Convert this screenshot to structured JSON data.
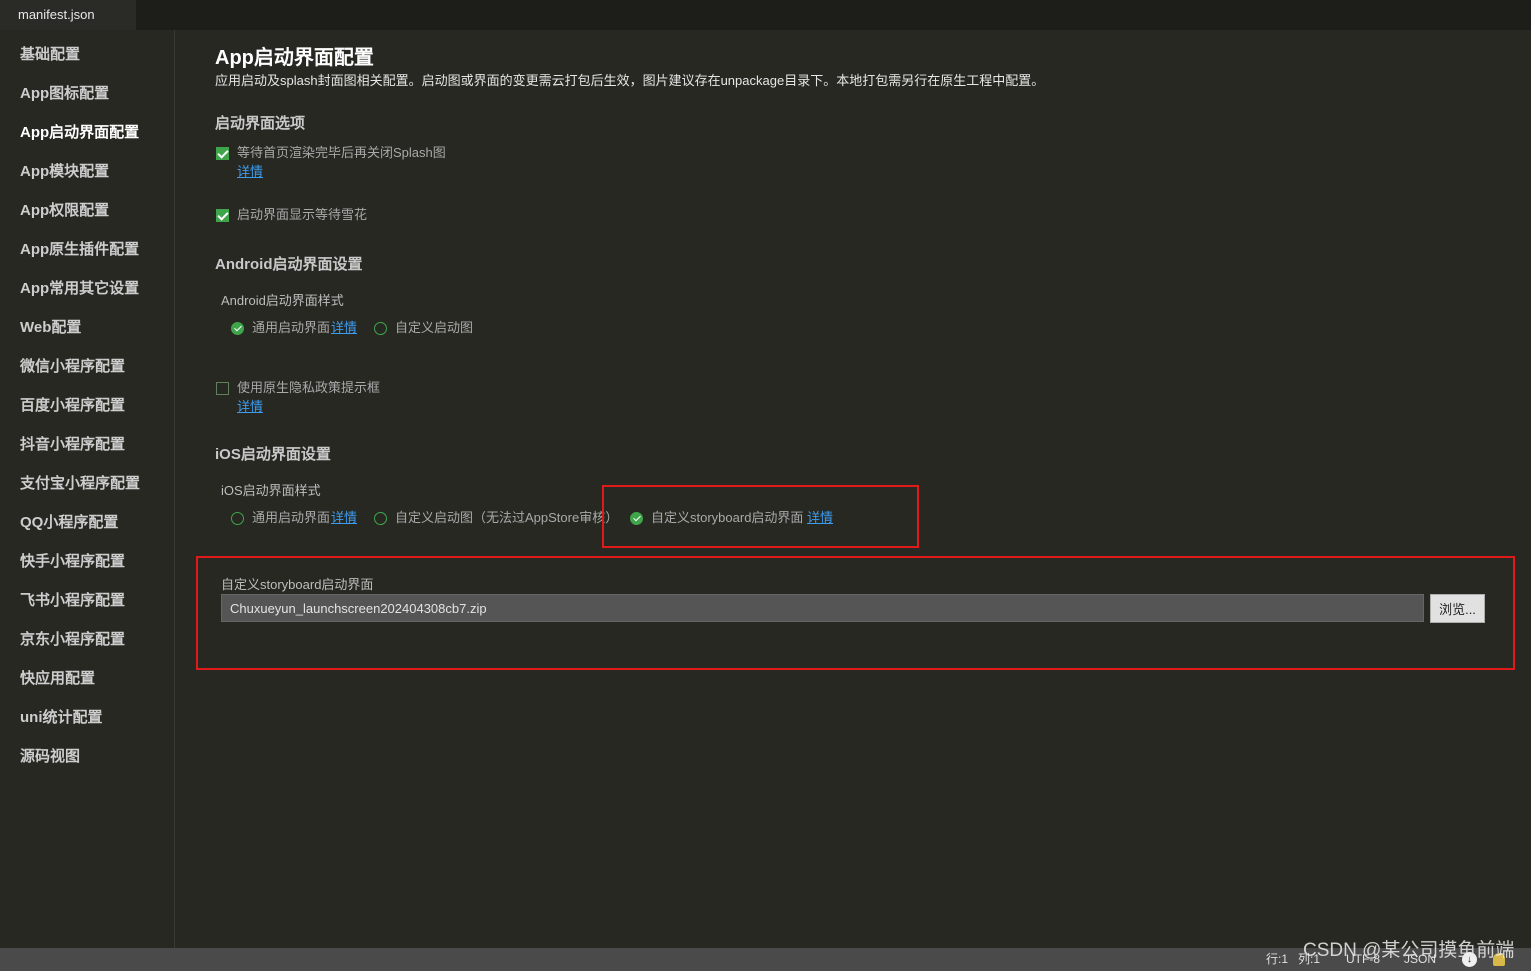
{
  "tab": {
    "title": "manifest.json"
  },
  "sidebar": {
    "items": [
      {
        "label": "基础配置"
      },
      {
        "label": "App图标配置"
      },
      {
        "label": "App启动界面配置",
        "active": true
      },
      {
        "label": "App模块配置"
      },
      {
        "label": "App权限配置"
      },
      {
        "label": "App原生插件配置"
      },
      {
        "label": "App常用其它设置"
      },
      {
        "label": "Web配置"
      },
      {
        "label": "微信小程序配置"
      },
      {
        "label": "百度小程序配置"
      },
      {
        "label": "抖音小程序配置"
      },
      {
        "label": "支付宝小程序配置"
      },
      {
        "label": "QQ小程序配置"
      },
      {
        "label": "快手小程序配置"
      },
      {
        "label": "飞书小程序配置"
      },
      {
        "label": "京东小程序配置"
      },
      {
        "label": "快应用配置"
      },
      {
        "label": "uni统计配置"
      },
      {
        "label": "源码视图"
      }
    ]
  },
  "main": {
    "title": "App启动界面配置",
    "description": "应用启动及splash封面图相关配置。启动图或界面的变更需云打包后生效，图片建议存在unpackage目录下。本地打包需另行在原生工程中配置。",
    "splash_options": {
      "heading": "启动界面选项",
      "wait_render": {
        "label": "等待首页渲染完毕后再关闭Splash图",
        "checked": true,
        "link": "详情"
      },
      "waiting_spinner": {
        "label": "启动界面显示等待雪花",
        "checked": true
      }
    },
    "android": {
      "heading": "Android启动界面设置",
      "style_label": "Android启动界面样式",
      "options": [
        {
          "label": "通用启动界面",
          "selected": true,
          "link": "详情"
        },
        {
          "label": "自定义启动图",
          "selected": false
        }
      ],
      "privacy_dialog": {
        "label": "使用原生隐私政策提示框",
        "checked": false,
        "link": "详情"
      }
    },
    "ios": {
      "heading": "iOS启动界面设置",
      "style_label": "iOS启动界面样式",
      "options": [
        {
          "label": "通用启动界面",
          "selected": false,
          "link": "详情"
        },
        {
          "label": "自定义启动图（无法过AppStore审核）",
          "selected": false
        },
        {
          "label": "自定义storyboard启动界面",
          "selected": true,
          "link": "详情"
        }
      ],
      "storyboard": {
        "label": "自定义storyboard启动界面",
        "value": "Chuxueyun_launchscreen202404308cb7.zip",
        "browse_label": "浏览..."
      }
    }
  },
  "status_bar": {
    "line": "行:1",
    "column": "列:1",
    "encoding": "UTF-8",
    "language": "JSON",
    "icons": [
      "update-icon",
      "bell-icon"
    ]
  },
  "watermark": "CSDN @某公司摸鱼前端",
  "colors": {
    "accent": "#3fa54b",
    "link": "#3b9cf0",
    "annotation": "#e0191b"
  }
}
